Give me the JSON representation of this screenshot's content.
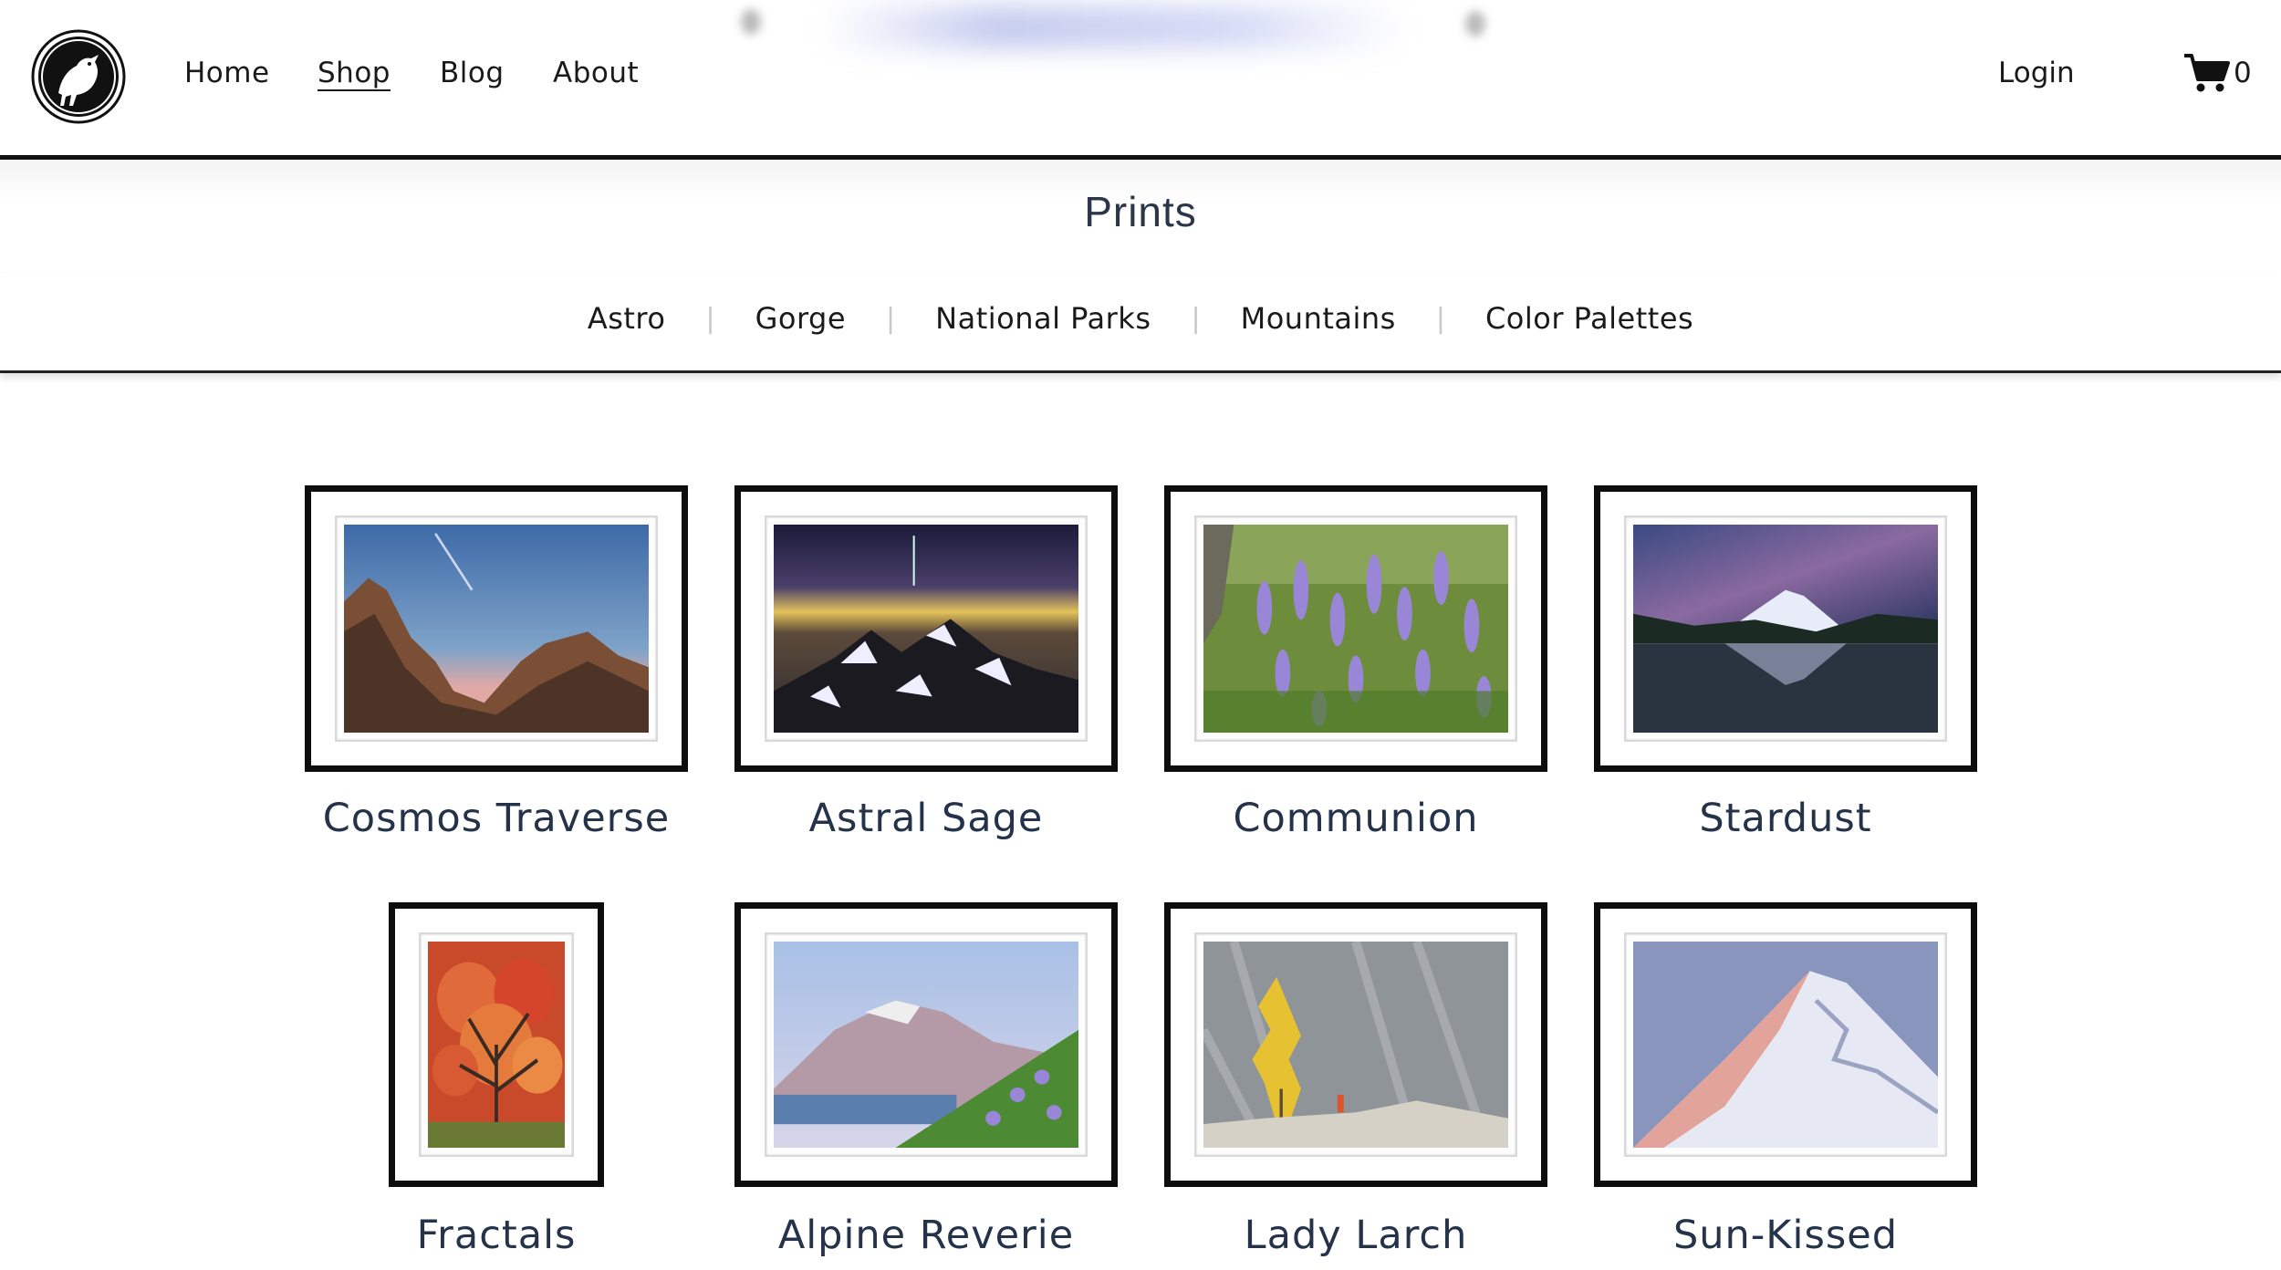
{
  "nav": {
    "items": [
      {
        "label": "Home"
      },
      {
        "label": "Shop"
      },
      {
        "label": "Blog"
      },
      {
        "label": "About"
      }
    ],
    "login_label": "Login",
    "cart_count": "0"
  },
  "page": {
    "title": "Prints"
  },
  "categories": [
    "Astro",
    "Gorge",
    "National Parks",
    "Mountains",
    "Color Palettes"
  ],
  "prints": [
    {
      "title": "Cosmos Traverse"
    },
    {
      "title": "Astral Sage"
    },
    {
      "title": "Communion"
    },
    {
      "title": "Stardust"
    },
    {
      "title": "Fractals"
    },
    {
      "title": "Alpine Reverie"
    },
    {
      "title": "Lady Larch"
    },
    {
      "title": "Sun-Kissed"
    }
  ],
  "icons": {
    "logo": "raven-logo-icon",
    "cart": "shopping-cart-icon"
  }
}
